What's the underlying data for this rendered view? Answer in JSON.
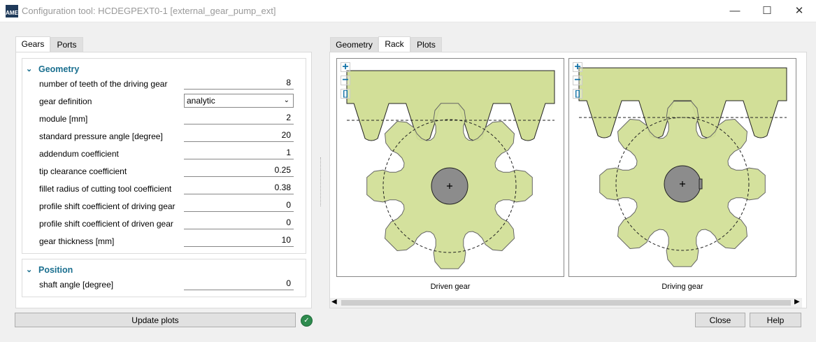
{
  "window": {
    "logo": "AME",
    "title": "Configuration tool: HCDEGPEXT0-1 [external_gear_pump_ext]",
    "minimize": "—",
    "maximize": "☐",
    "close": "✕"
  },
  "left_tabs": [
    {
      "label": "Gears",
      "active": true
    },
    {
      "label": "Ports",
      "active": false
    }
  ],
  "geometry": {
    "heading": "Geometry",
    "rows": [
      {
        "label": "number of teeth of the driving gear",
        "value": "8"
      },
      {
        "label": "gear definition",
        "value": "analytic",
        "type": "select"
      },
      {
        "label": "module [mm]",
        "value": "2"
      },
      {
        "label": "standard pressure angle [degree]",
        "value": "20"
      },
      {
        "label": "addendum coefficient",
        "value": "1"
      },
      {
        "label": "tip clearance coefficient",
        "value": "0.25"
      },
      {
        "label": "fillet radius of cutting tool coefficient",
        "value": "0.38"
      },
      {
        "label": "profile shift coefficient of driving gear",
        "value": "0"
      },
      {
        "label": "profile shift coefficient of driven gear",
        "value": "0"
      },
      {
        "label": "gear thickness [mm]",
        "value": "10"
      }
    ]
  },
  "position": {
    "heading": "Position",
    "rows": [
      {
        "label": "shaft angle [degree]",
        "value": "0"
      }
    ]
  },
  "update_button": "Update plots",
  "status": {
    "icon": "check-circle-icon",
    "color": "#2e8b4e"
  },
  "right_tabs": [
    {
      "label": "Geometry",
      "active": false
    },
    {
      "label": "Rack",
      "active": true
    },
    {
      "label": "Plots",
      "active": false
    }
  ],
  "views": [
    {
      "caption": "Driven gear",
      "keyway": false
    },
    {
      "caption": "Driving gear",
      "keyway": true
    }
  ],
  "zoom_controls": {
    "zoom_in": "+",
    "zoom_out": "−",
    "fit": "[]"
  },
  "colors": {
    "gear_fill": "#d2df98",
    "hub_fill": "#8c8c8c",
    "accent": "#1a6f8f"
  },
  "footer": {
    "close": "Close",
    "help": "Help"
  }
}
